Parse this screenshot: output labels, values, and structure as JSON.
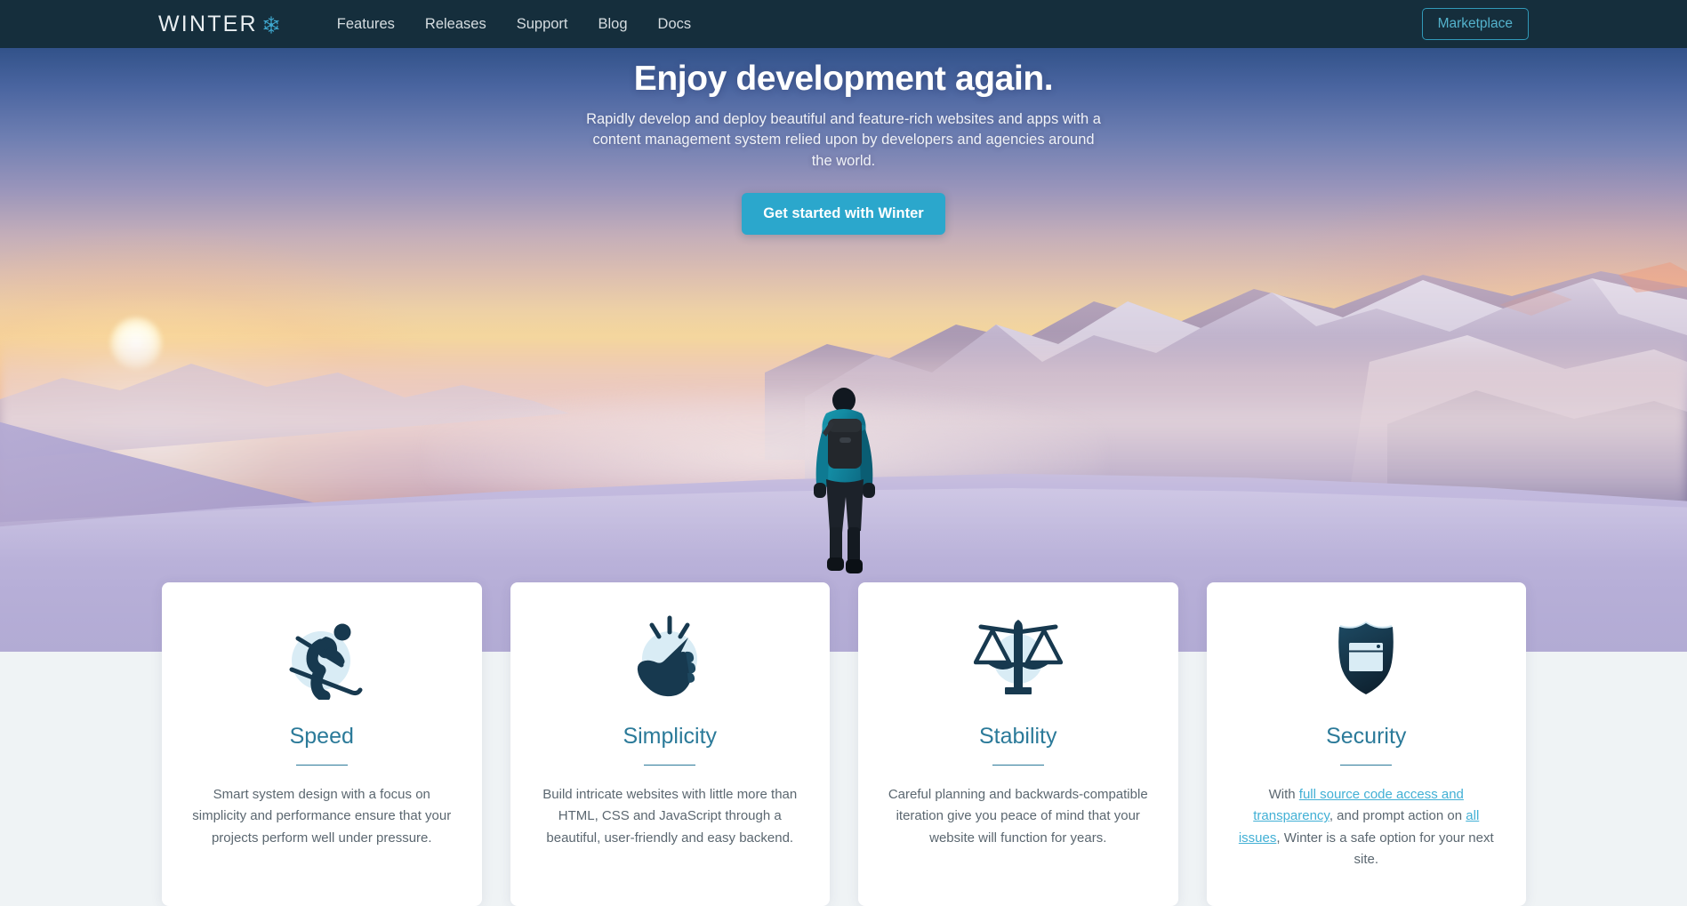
{
  "navbar": {
    "brand": {
      "text": "WINTER",
      "icon": "snowflake-icon"
    },
    "links": [
      {
        "label": "Features"
      },
      {
        "label": "Releases"
      },
      {
        "label": "Support"
      },
      {
        "label": "Blog"
      },
      {
        "label": "Docs"
      }
    ],
    "marketplace_label": "Marketplace",
    "background_color": "#152e3c",
    "accent_color": "#54b3cd"
  },
  "hero": {
    "title": "Enjoy development again.",
    "subtitle": "Rapidly develop and deploy beautiful and feature-rich websites and apps with a content management system relied upon by developers and agencies around the world.",
    "cta_label": "Get started with Winter",
    "cta_color": "#2ba7cc",
    "background_scene": "winter-mountain-sunset-hiker"
  },
  "features": [
    {
      "icon": "skier-icon",
      "title": "Speed",
      "description": "Smart system design with a focus on simplicity and performance ensure that your projects perform well under pressure."
    },
    {
      "icon": "snapping-fingers-icon",
      "title": "Simplicity",
      "description": "Build intricate websites with little more than HTML, CSS and JavaScript through a beautiful, user-friendly and easy backend."
    },
    {
      "icon": "balance-scales-icon",
      "title": "Stability",
      "description": "Careful planning and backwards-compatible iteration give you peace of mind that your website will function for years."
    },
    {
      "icon": "shield-browser-icon",
      "title": "Security",
      "security_parts": {
        "lead": "With ",
        "link1": "full source code access and transparency",
        "mid": ", and prompt action on ",
        "link2": "all issues",
        "tail": ", Winter is a safe option for your next site."
      }
    }
  ],
  "theme": {
    "heading_color": "#2b7a99",
    "body_text_color": "#5b6770",
    "link_color": "#42b0d5",
    "page_background": "#eff3f5",
    "card_background": "#ffffff",
    "icon_dark": "#17394f",
    "icon_circle": "#d9ecf5"
  }
}
